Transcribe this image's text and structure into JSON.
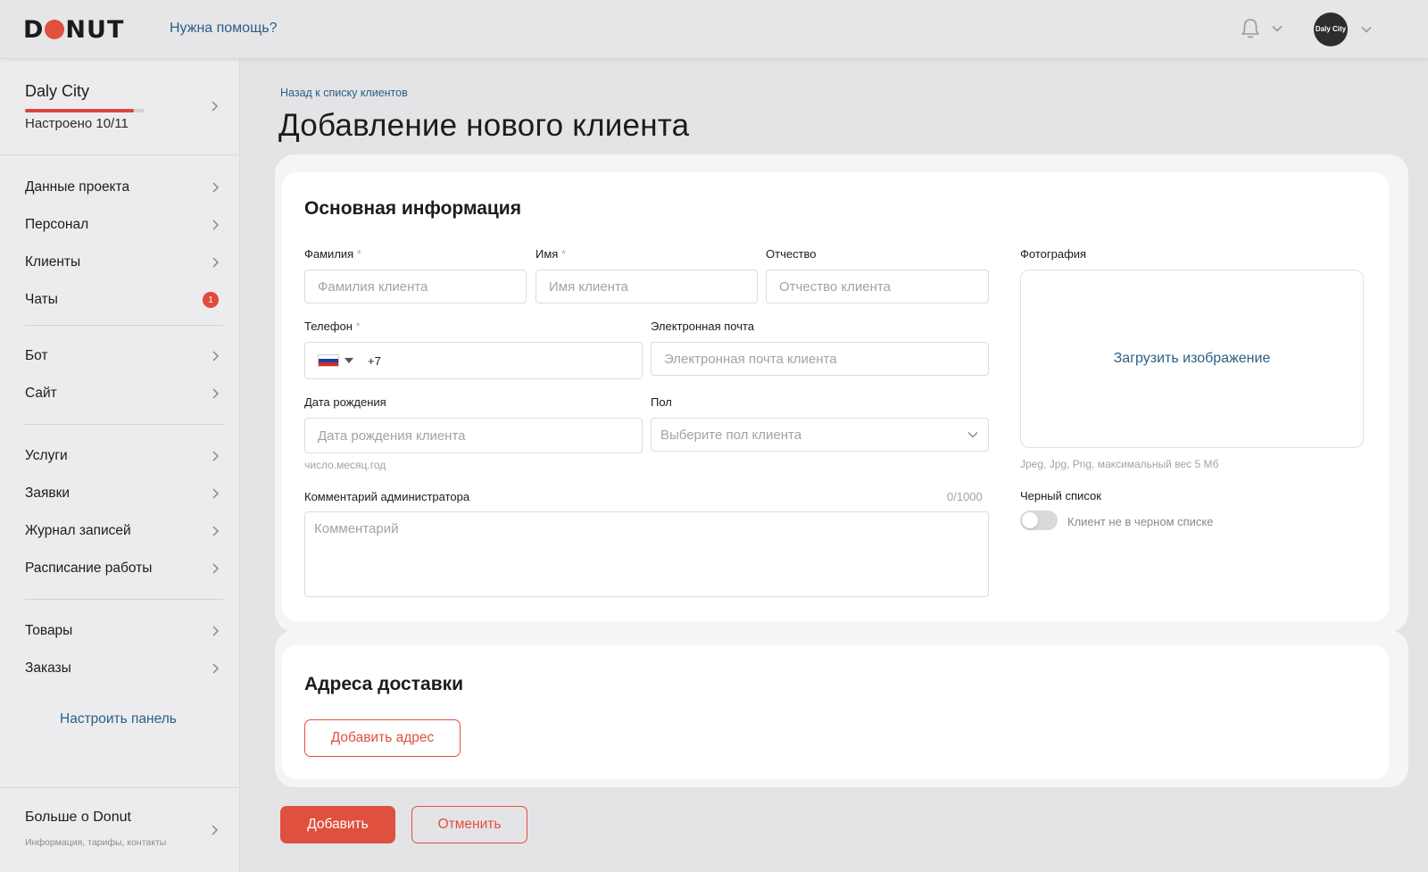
{
  "header": {
    "logo": "DONUT",
    "help_link": "Нужна помощь?",
    "avatar_text": "Daly City"
  },
  "sidebar": {
    "city": {
      "name": "Daly City",
      "status": "Настроено 10/11",
      "progress": 0.91
    },
    "groups": [
      [
        {
          "label": "Данные проекта",
          "chevron": true
        },
        {
          "label": "Персонал",
          "chevron": true
        },
        {
          "label": "Клиенты",
          "chevron": true
        },
        {
          "label": "Чаты",
          "badge": "1"
        }
      ],
      [
        {
          "label": "Бот",
          "chevron": true
        },
        {
          "label": "Сайт",
          "chevron": true
        }
      ],
      [
        {
          "label": "Услуги",
          "chevron": true
        },
        {
          "label": "Заявки",
          "chevron": true
        },
        {
          "label": "Журнал записей",
          "chevron": true
        },
        {
          "label": "Расписание работы",
          "chevron": true
        }
      ],
      [
        {
          "label": "Товары",
          "chevron": true
        },
        {
          "label": "Заказы",
          "chevron": true
        }
      ]
    ],
    "customize_link": "Настроить панель",
    "more": {
      "title": "Больше о Donut",
      "subtitle": "Информация, тарифы, контакты"
    }
  },
  "main": {
    "back_link": "Назад к списку клиентов",
    "title": "Добавление нового клиента",
    "basic_info": {
      "title": "Основная информация",
      "last_name": {
        "label": "Фамилия",
        "required": "*",
        "placeholder": "Фамилия клиента",
        "value": ""
      },
      "first_name": {
        "label": "Имя",
        "required": "*",
        "placeholder": "Имя клиента",
        "value": ""
      },
      "patronymic": {
        "label": "Отчество",
        "placeholder": "Отчество клиента",
        "value": ""
      },
      "phone": {
        "label": "Телефон",
        "required": "*",
        "code": "+7",
        "value": ""
      },
      "email": {
        "label": "Электронная почта",
        "placeholder": "Электронная почта клиента",
        "value": ""
      },
      "birth_date": {
        "label": "Дата рождения",
        "placeholder": "Дата рождения клиента",
        "hint": "число.месяц.год",
        "value": ""
      },
      "gender": {
        "label": "Пол",
        "placeholder": "Выберите пол клиента"
      },
      "comment": {
        "label": "Комментарий администратора",
        "counter": "0/1000",
        "placeholder": "Комментарий",
        "value": ""
      },
      "photo": {
        "label": "Фотография",
        "upload": "Загрузить изображение",
        "hint": "Jpeg, Jpg, Png, максимальный вес 5 Мб"
      },
      "blacklist": {
        "label": "Черный список",
        "toggle_label": "Клиент не в черном списке",
        "enabled": false
      }
    },
    "delivery": {
      "title": "Адреса доставки",
      "add_button": "Добавить адрес"
    },
    "actions": {
      "submit": "Добавить",
      "cancel": "Отменить"
    }
  },
  "colors": {
    "accent": "#e0503f",
    "link": "#2a5f86",
    "background": "#e4e4e6"
  },
  "icons": [
    "bell-icon",
    "chevron-down-icon",
    "chevron-right-icon",
    "russia-flag-icon"
  ]
}
